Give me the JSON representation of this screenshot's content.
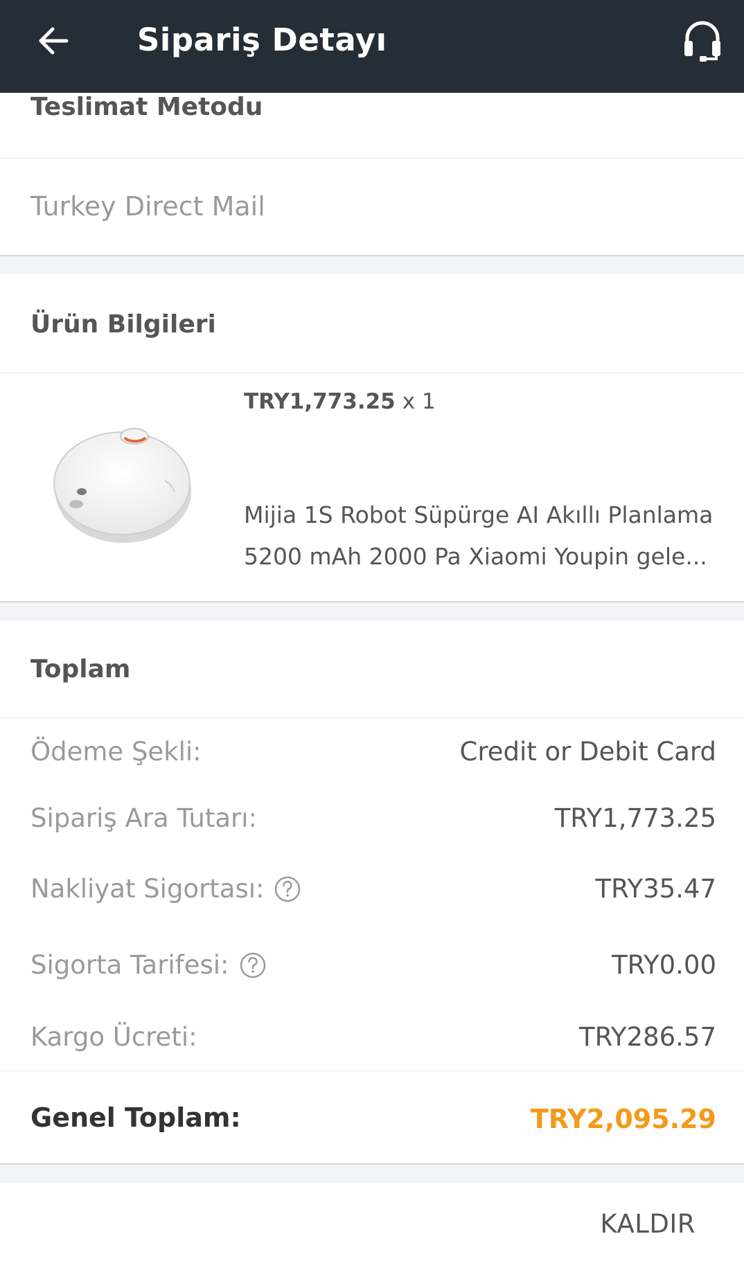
{
  "header": {
    "title": "Sipariş Detayı",
    "back_icon": "arrow-left-icon",
    "support_icon": "headset-icon",
    "background": "#252d36"
  },
  "delivery": {
    "title": "Teslimat Metodu",
    "method": "Turkey Direct Mail"
  },
  "product_info": {
    "title": "Ürün Bilgileri",
    "item": {
      "price": "TRY1,773.25",
      "quantity": "x 1",
      "name": "Mijia 1S Robot Süpürge AI Akıllı Planlama 5200 mAh 2000 Pa Xiaomi Youpin gele..."
    }
  },
  "totals": {
    "title": "Toplam",
    "rows": [
      {
        "label": "Ödeme Şekli:",
        "value": "Credit or Debit Card"
      },
      {
        "label": "Sipariş Ara Tutarı:",
        "value": "TRY1,773.25"
      },
      {
        "label": "Nakliyat Sigortası:",
        "value": "TRY35.47"
      },
      {
        "label": "Sigorta Tarifesi:",
        "value": "TRY0.00"
      },
      {
        "label": "Kargo Ücreti:",
        "value": "TRY286.57"
      }
    ],
    "grand_total_label": "Genel Toplam:",
    "grand_total_value": "TRY2,095.29",
    "accent_color": "#f39a1b"
  },
  "footer": {
    "remove_label": "KALDIR"
  }
}
